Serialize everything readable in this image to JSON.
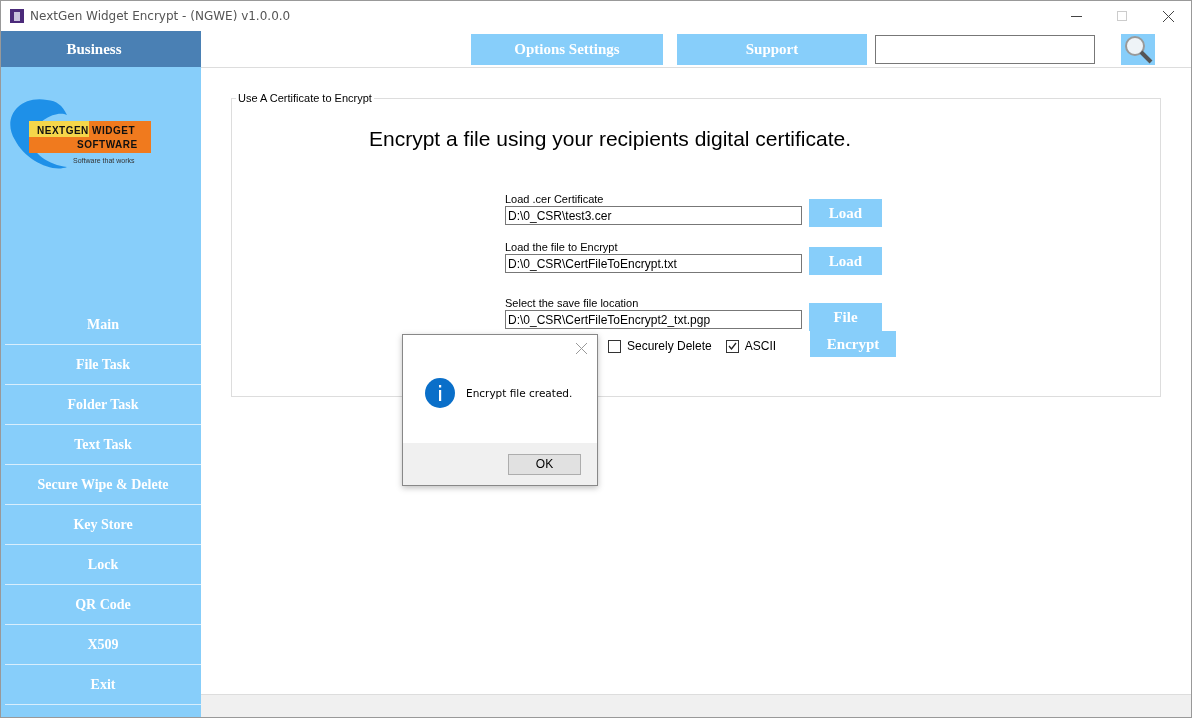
{
  "window": {
    "title": "NextGen Widget Encrypt - (NGWE) v1.0.0.0"
  },
  "sidebar": {
    "header": "Business",
    "logo": {
      "line_1": "NEXTGEN WIDGET",
      "line_2": "SOFTWARE",
      "tagline": "Software that works"
    },
    "items": [
      "Main",
      "File Task",
      "Folder Task",
      "Text Task",
      "Secure Wipe & Delete",
      "Key Store",
      "Lock",
      "QR Code",
      "X509",
      "Exit"
    ]
  },
  "toolbar": {
    "buttons": [
      "Options Settings",
      "Support"
    ]
  },
  "group": {
    "title": "Use A Certificate to Encrypt",
    "heading": "Encrypt a file using your recipients digital certificate.",
    "fields": [
      {
        "label": "Load .cer Certificate",
        "value": "D:\\0_CSR\\test3.cer",
        "button": "Load"
      },
      {
        "label": "Load the file to Encrypt",
        "value": "D:\\0_CSR\\CertFileToEncrypt.txt",
        "button": "Load"
      },
      {
        "label": "Select the save file location",
        "value": "D:\\0_CSR\\CertFileToEncrypt2_txt.pgp",
        "button": "File"
      }
    ],
    "options": [
      {
        "label": "Securely Delete",
        "checked": false
      },
      {
        "label": "ASCII",
        "checked": true
      }
    ],
    "action": "Encrypt"
  },
  "dialog": {
    "message": "Encrypt file created.",
    "button": "OK"
  }
}
